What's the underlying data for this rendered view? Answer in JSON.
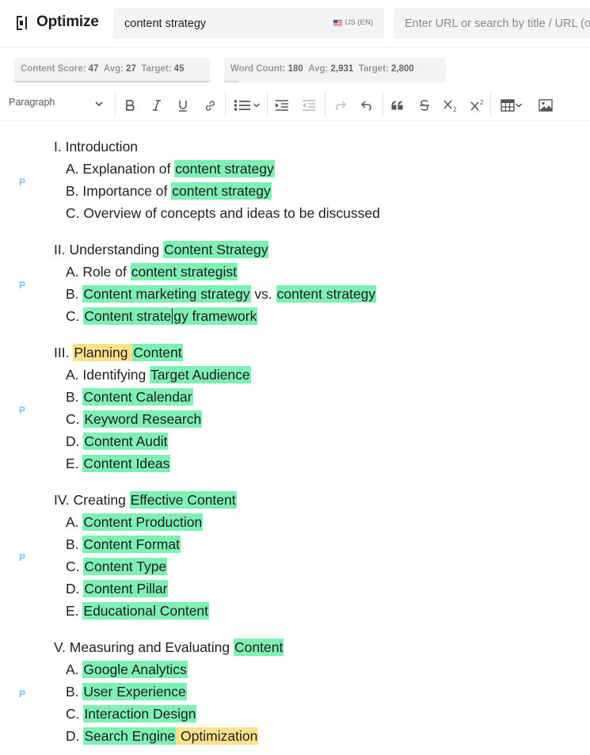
{
  "header": {
    "app_title": "Optimize",
    "search_value": "content strategy",
    "locale": "US (EN)",
    "url_placeholder": "Enter URL or search by title / URL (o"
  },
  "metrics": {
    "content_score": {
      "label": "Content Score:",
      "value": "47",
      "avg_label": "Avg:",
      "avg": "27",
      "target_label": "Target:",
      "target": "45"
    },
    "word_count": {
      "label": "Word Count:",
      "value": "180",
      "avg_label": "Avg:",
      "avg": "2,931",
      "target_label": "Target:",
      "target": "2,800",
      "progress": 0.064
    }
  },
  "toolbar": {
    "paragraph_select": "Paragraph",
    "buttons": [
      "bold-icon",
      "italic-icon",
      "underline-icon",
      "link-icon",
      "bullet-list-icon",
      "indent-icon",
      "outdent-icon",
      "redo-icon",
      "undo-icon",
      "quote-icon",
      "strikethrough-icon",
      "subscript-icon",
      "superscript-icon",
      "table-icon",
      "image-icon"
    ]
  },
  "colors": {
    "highlight_green": "#7ff0b3",
    "highlight_yellow": "#fde28b",
    "paragraph_marker": "#7cc2f0"
  },
  "document": {
    "paragraph_marker": "P",
    "sections": [
      {
        "heading": [
          {
            "t": "I. Introduction"
          }
        ],
        "items": [
          [
            {
              "t": "A. Explanation of "
            },
            {
              "t": "content strategy",
              "h": "green"
            }
          ],
          [
            {
              "t": "B. Importance of "
            },
            {
              "t": "content strategy",
              "h": "green"
            }
          ],
          [
            {
              "t": "C. Overview of concepts and ideas to be discussed"
            }
          ]
        ]
      },
      {
        "heading": [
          {
            "t": "II. Understanding "
          },
          {
            "t": "Content Strategy",
            "h": "green"
          }
        ],
        "items": [
          [
            {
              "t": "A. Role of "
            },
            {
              "t": "content strategist",
              "h": "green"
            }
          ],
          [
            {
              "t": "B. "
            },
            {
              "t": "Content marketing strategy",
              "h": "green"
            },
            {
              "t": " vs. "
            },
            {
              "t": "content strategy",
              "h": "green"
            }
          ],
          [
            {
              "t": "C. "
            },
            {
              "t": "Content strate",
              "h": "green",
              "caret": true
            },
            {
              "t": "gy framework",
              "h": "green"
            }
          ]
        ]
      },
      {
        "heading": [
          {
            "t": "III. "
          },
          {
            "t": "Planning ",
            "h": "yellow"
          },
          {
            "t": "Content",
            "h": "green"
          }
        ],
        "items": [
          [
            {
              "t": "A. Identifying "
            },
            {
              "t": "Target Audience",
              "h": "green"
            }
          ],
          [
            {
              "t": "B. "
            },
            {
              "t": "Content Calendar",
              "h": "green"
            }
          ],
          [
            {
              "t": "C. "
            },
            {
              "t": "Keyword Research",
              "h": "green"
            }
          ],
          [
            {
              "t": "D. "
            },
            {
              "t": "Content Audit",
              "h": "green"
            }
          ],
          [
            {
              "t": "E. "
            },
            {
              "t": "Content Ideas",
              "h": "green"
            }
          ]
        ]
      },
      {
        "heading": [
          {
            "t": "IV. Creating "
          },
          {
            "t": "Effective Content",
            "h": "green"
          }
        ],
        "items": [
          [
            {
              "t": "A. "
            },
            {
              "t": "Content Production",
              "h": "green"
            }
          ],
          [
            {
              "t": "B. "
            },
            {
              "t": "Content Format",
              "h": "green"
            }
          ],
          [
            {
              "t": "C. "
            },
            {
              "t": "Content Type",
              "h": "green"
            }
          ],
          [
            {
              "t": "D. "
            },
            {
              "t": "Content Pillar",
              "h": "green"
            }
          ],
          [
            {
              "t": "E. "
            },
            {
              "t": "Educational Content",
              "h": "green"
            }
          ]
        ]
      },
      {
        "heading": [
          {
            "t": "V. Measuring and Evaluating "
          },
          {
            "t": "Content",
            "h": "green"
          }
        ],
        "items": [
          [
            {
              "t": "A. "
            },
            {
              "t": "Google Analytics",
              "h": "green"
            }
          ],
          [
            {
              "t": "B. "
            },
            {
              "t": "User Experience",
              "h": "green"
            }
          ],
          [
            {
              "t": "C. "
            },
            {
              "t": "Interaction Design",
              "h": "green"
            }
          ],
          [
            {
              "t": "D. "
            },
            {
              "t": "Search Engine",
              "h": "green"
            },
            {
              "t": " Optimization",
              "h": "yellow"
            }
          ]
        ]
      }
    ]
  }
}
